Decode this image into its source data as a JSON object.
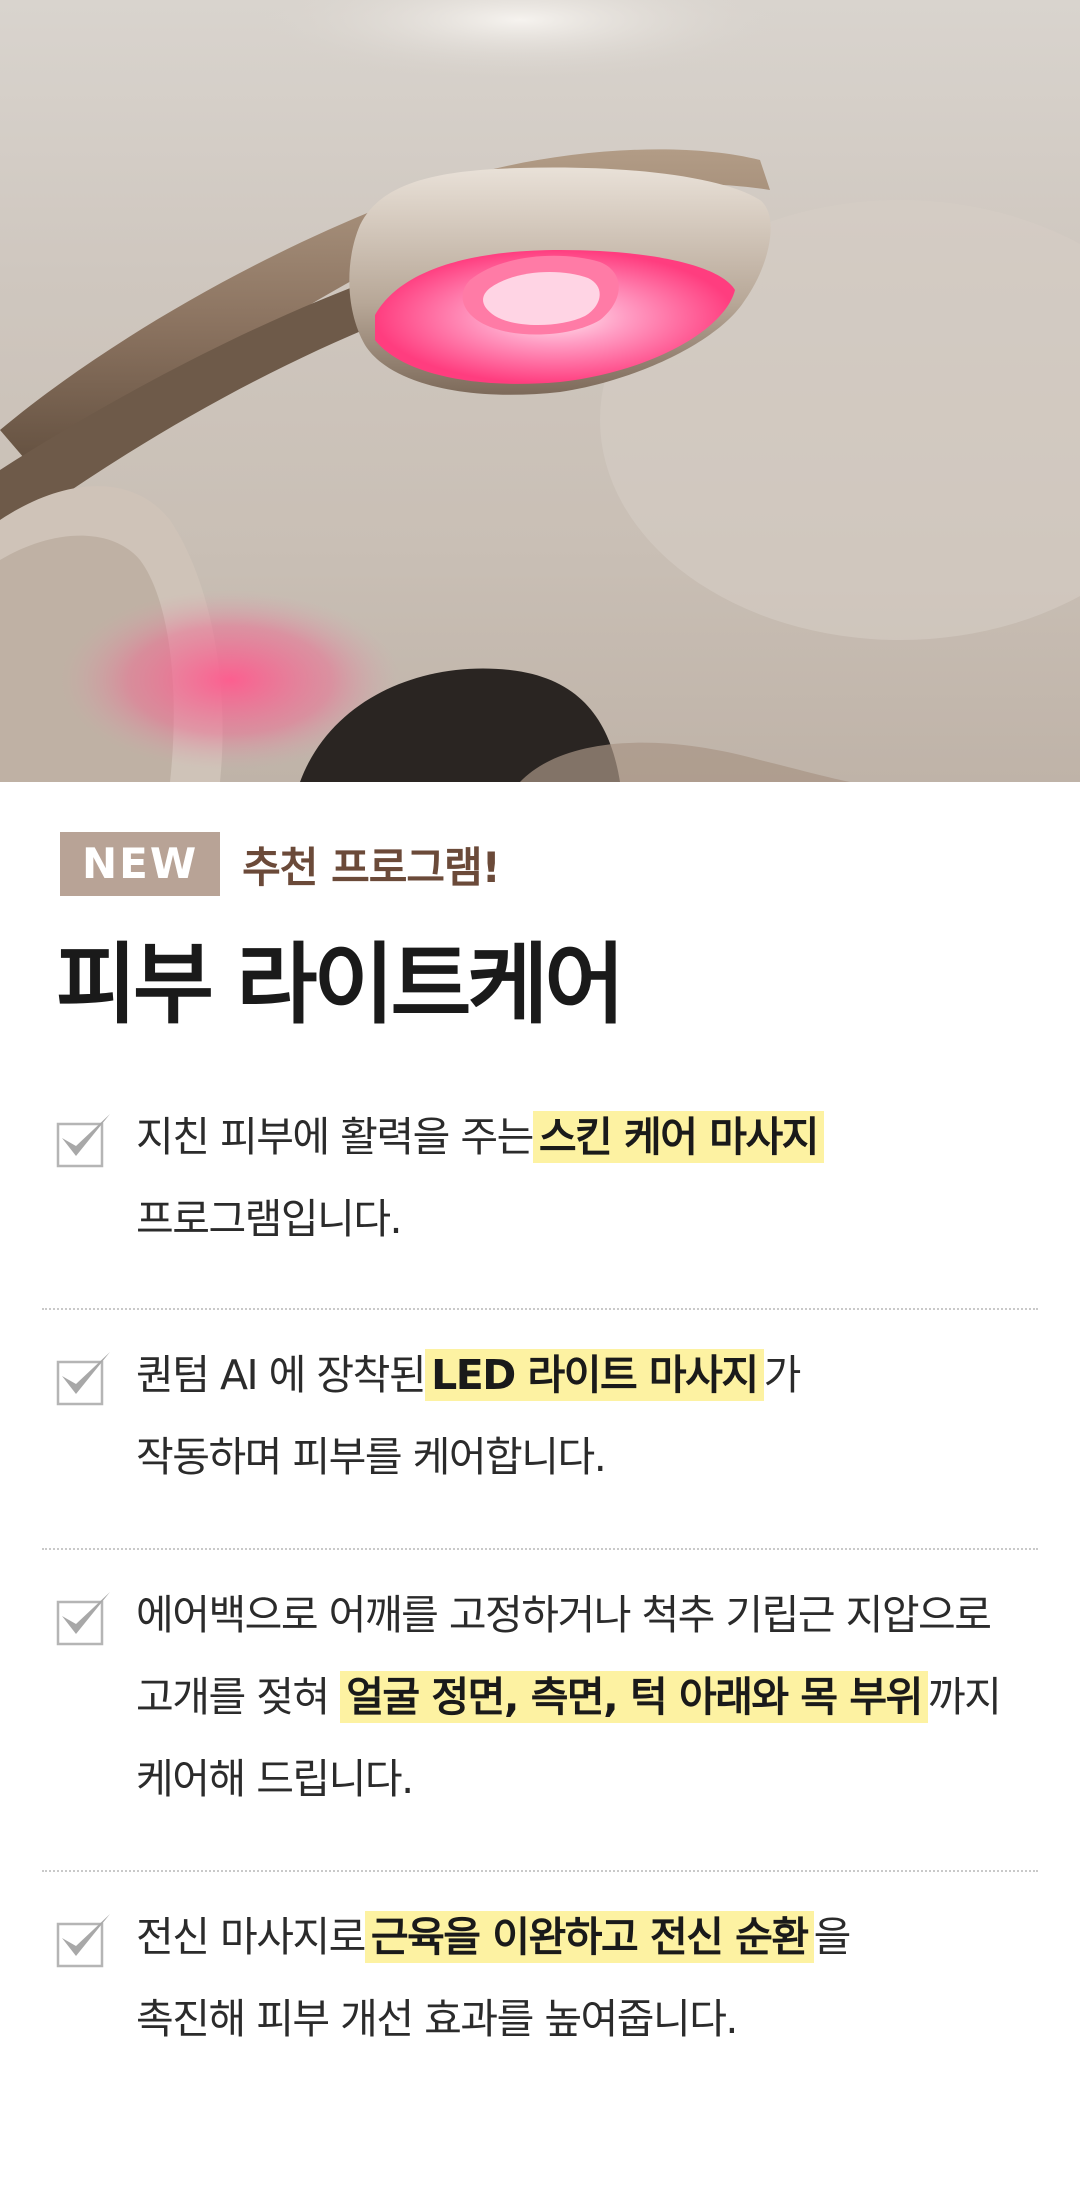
{
  "header": {
    "badge": "NEW",
    "subtitle": "추천 프로그램!",
    "title": "피부 라이트케어"
  },
  "features": [
    {
      "line1_pre": "지친 피부에 활력을 주는",
      "line1_hl": "스킨 케어 마사지",
      "line1_post": "",
      "line2_pre": "프로그램입니다.",
      "line2_hl": "",
      "line2_post": ""
    },
    {
      "line1_pre": "퀀텀 AI 에 장착된",
      "line1_hl": "LED 라이트 마사지",
      "line1_post": "가",
      "line2_pre": "작동하며 피부를 케어합니다.",
      "line2_hl": "",
      "line2_post": ""
    },
    {
      "line1_pre": "에어백으로 어깨를 고정하거나 척추 기립근 지압으로",
      "line1_hl": "",
      "line1_post": "",
      "line2_pre": "고개를 젖혀",
      "line2_hl": "얼굴 정면, 측면, 턱 아래와 목 부위",
      "line2_post": "까지",
      "line3_pre": "케어해 드립니다."
    },
    {
      "line1_pre": "전신 마사지로",
      "line1_hl": "근육을 이완하고 전신 순환",
      "line1_post": "을",
      "line2_pre": "촉진해 피부 개선 효과를 높여줍니다.",
      "line2_hl": "",
      "line2_post": ""
    }
  ],
  "colors": {
    "badge_bg": "#b8a396",
    "subtitle": "#6b4a39",
    "highlight": "#fdf2a2",
    "led_pink": "#ff3d7f"
  },
  "icons": {
    "check": "check-icon"
  }
}
